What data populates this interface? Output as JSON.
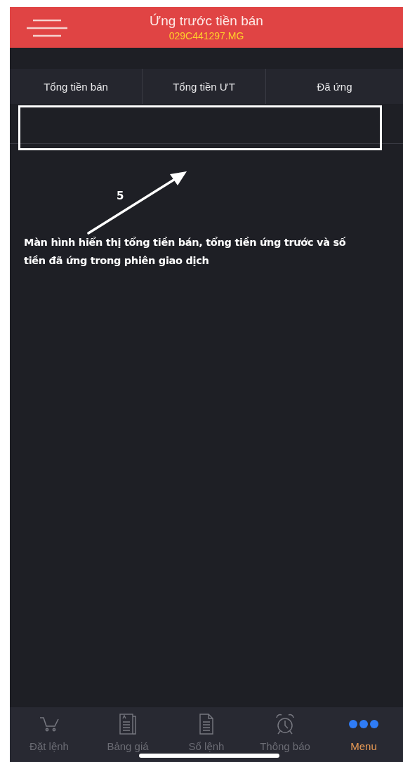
{
  "header": {
    "title": "Ứng trước tiền bán",
    "subtitle": "029C441297.MG"
  },
  "columns": [
    "Tổng tiền bán",
    "Tổng tiền ƯT",
    "Đã ứng"
  ],
  "annotation": {
    "number": "5",
    "text": "Màn hình hiển thị tổng tiền bán, tổng tiền ứng trước và số tiền đã ứng trong phiên giao dịch"
  },
  "tab_bar": [
    {
      "kind": "cart",
      "label": "Đặt lệnh",
      "selected": false
    },
    {
      "kind": "pricelist",
      "label": "Bảng giá",
      "selected": false
    },
    {
      "kind": "document",
      "label": "Sổ lệnh",
      "selected": false
    },
    {
      "kind": "alarm",
      "label": "Thông báo",
      "selected": false
    },
    {
      "kind": "dots",
      "label": "Menu",
      "selected": true
    }
  ]
}
